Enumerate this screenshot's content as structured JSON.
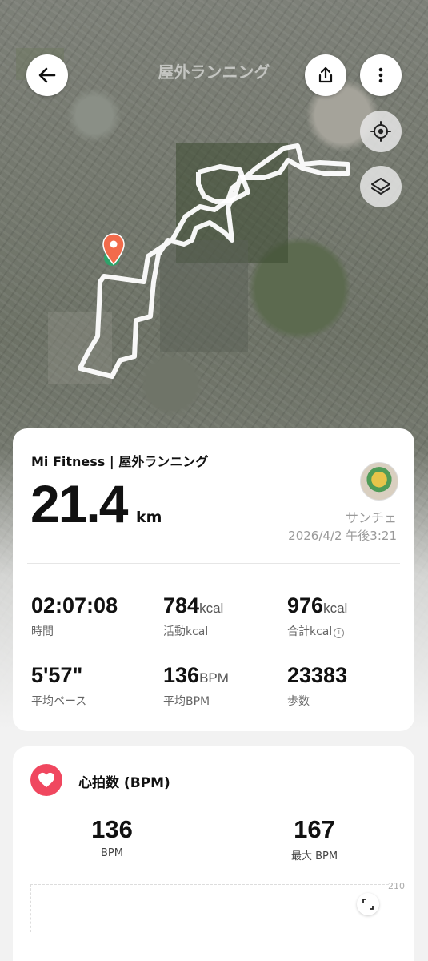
{
  "header": {
    "title": "屋外ランニング"
  },
  "summary": {
    "source": "Mi Fitness | 屋外ランニング",
    "distance_value": "21.4",
    "distance_unit": "km",
    "user_name": "サンチェ",
    "datetime": "2026/4/2 午後3:21",
    "stats": [
      {
        "value": "02:07:08",
        "unit": "",
        "label": "時間"
      },
      {
        "value": "784",
        "unit": "kcal",
        "label": "活動kcal"
      },
      {
        "value": "976",
        "unit": "kcal",
        "label": "合計kcal"
      },
      {
        "value": "5'57\"",
        "unit": "",
        "label": "平均ペース"
      },
      {
        "value": "136",
        "unit": "BPM",
        "label": "平均BPM"
      },
      {
        "value": "23383",
        "unit": "",
        "label": "歩数"
      }
    ]
  },
  "heart_rate": {
    "title": "心拍数 (BPM)",
    "avg_value": "136",
    "avg_label": "BPM",
    "max_value": "167",
    "max_label": "最大 BPM",
    "chart_max": "210"
  },
  "colors": {
    "heart_accent": "#f0475f",
    "pin": "#f26b4b",
    "route": "#ffffff"
  },
  "icons": {
    "back": "back-arrow-icon",
    "share": "share-icon",
    "more": "more-vertical-icon",
    "locate": "locate-icon",
    "layers": "layers-icon",
    "pin": "map-pin-icon",
    "heart": "heart-icon",
    "expand": "expand-icon"
  }
}
